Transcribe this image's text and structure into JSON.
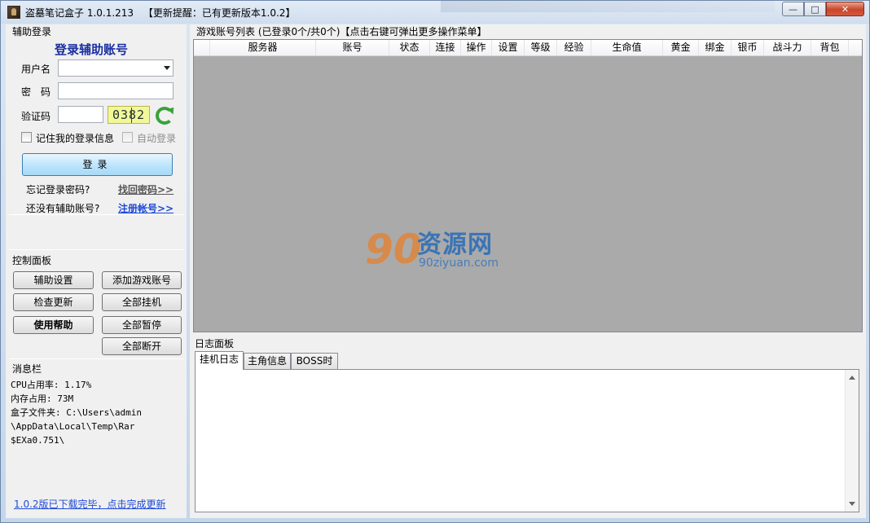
{
  "window": {
    "title": "盗墓笔记盒子 1.0.1.213",
    "update_notice": "【更新提醒：已有更新版本1.0.2】",
    "minimize": "—",
    "maximize": "□",
    "close": "✕"
  },
  "login": {
    "group_title": "辅助登录",
    "heading": "登录辅助账号",
    "username_label": "用户名",
    "username_value": "",
    "password_label": "密　码",
    "password_value": "",
    "captcha_label": "验证码",
    "captcha_value": "",
    "captcha_text": "0382",
    "remember_label": "记住我的登录信息",
    "remember_checked": false,
    "auto_login_label": "自动登录",
    "auto_login_checked": false,
    "login_button": "登录",
    "forgot_text": "忘记登录密码?",
    "forgot_link": "找回密码>>",
    "no_account_text": "还没有辅助账号?",
    "register_link": "注册帐号>>"
  },
  "control": {
    "group_title": "控制面板",
    "buttons": {
      "settings": "辅助设置",
      "add_account": "添加游戏账号",
      "check_update": "检查更新",
      "start_all": "全部挂机",
      "help": "使用帮助",
      "pause_all": "全部暂停",
      "disconnect_all": "全部断开"
    }
  },
  "messages": {
    "group_title": "消息栏",
    "text": "CPU占用率: 1.17%\n内存占用: 73M\n盒子文件夹: C:\\Users\\admin\n\\AppData\\Local\\Temp\\Rar\n$EXa0.751\\",
    "update_link": "1.0.2版已下载完毕，点击完成更新"
  },
  "accounts": {
    "title": "游戏账号列表 (已登录0个/共0个)【点击右键可弹出更多操作菜单】",
    "columns": [
      "服务器",
      "账号",
      "状态",
      "连接",
      "操作",
      "设置",
      "等级",
      "经验",
      "生命值",
      "黄金",
      "绑金",
      "银币",
      "战斗力",
      "背包"
    ],
    "rows": []
  },
  "watermark": {
    "mark": "90",
    "cn": "资源网",
    "url": "90ziyuan.com"
  },
  "log": {
    "title": "日志面板",
    "tabs": [
      "挂机日志",
      "主角信息",
      "BOSS时间"
    ],
    "active_tab": 0,
    "content": ""
  }
}
